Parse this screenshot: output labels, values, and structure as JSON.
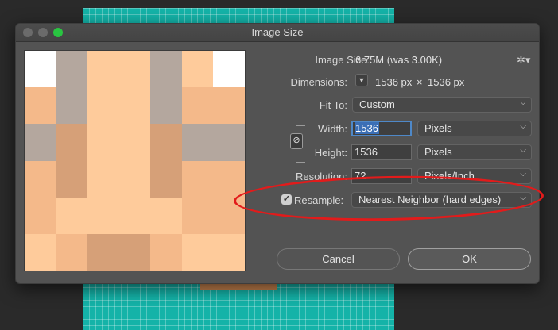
{
  "window": {
    "title": "Image Size"
  },
  "info": {
    "image_size_label": "Image Size:",
    "image_size_value": "6.75M (was 3.00K)",
    "dimensions_label": "Dimensions:",
    "dimensions_width": "1536 px",
    "dimensions_sep": "×",
    "dimensions_height": "1536 px"
  },
  "form": {
    "fit_to_label": "Fit To:",
    "fit_to_value": "Custom",
    "width_label": "Width:",
    "width_value": "1536",
    "width_unit": "Pixels",
    "height_label": "Height:",
    "height_value": "1536",
    "height_unit": "Pixels",
    "resolution_label": "Resolution:",
    "resolution_value": "72",
    "resolution_unit": "Pixels/Inch",
    "resample_label": "Resample:",
    "resample_checked": true,
    "resample_value": "Nearest Neighbor (hard edges)"
  },
  "buttons": {
    "cancel": "Cancel",
    "ok": "OK"
  },
  "icons": {
    "gear": "gear-icon",
    "link": "chain-link-icon",
    "chevron": "chevron-down-icon",
    "check": "checkmark-icon"
  },
  "colors": {
    "canvas_teal": "#14b3a8",
    "ok_accent": "#29c541",
    "annotation": "#e21b1b",
    "selection": "#3b6fb6"
  },
  "preview_pixels": [
    [
      "#ffffff",
      "#b4a79e",
      "#fecb9b",
      "#fecb9b",
      "#b4a79e",
      "#fecb9b",
      "#ffffff"
    ],
    [
      "#f4b98a",
      "#b4a79e",
      "#fecb9b",
      "#fecb9b",
      "#b4a79e",
      "#f4b98a",
      "#f4b98a"
    ],
    [
      "#b4a79e",
      "#d6a078",
      "#fecb9b",
      "#fecb9b",
      "#d6a078",
      "#b4a79e",
      "#b4a79e"
    ],
    [
      "#f4b98a",
      "#d6a078",
      "#fecb9b",
      "#fecb9b",
      "#d6a078",
      "#f4b98a",
      "#f4b98a"
    ],
    [
      "#f4b98a",
      "#fecb9b",
      "#fecb9b",
      "#fecb9b",
      "#fecb9b",
      "#f4b98a",
      "#f4b98a"
    ],
    [
      "#fecb9b",
      "#f4b98a",
      "#d6a078",
      "#d6a078",
      "#f4b98a",
      "#fecb9b",
      "#fecb9b"
    ]
  ]
}
